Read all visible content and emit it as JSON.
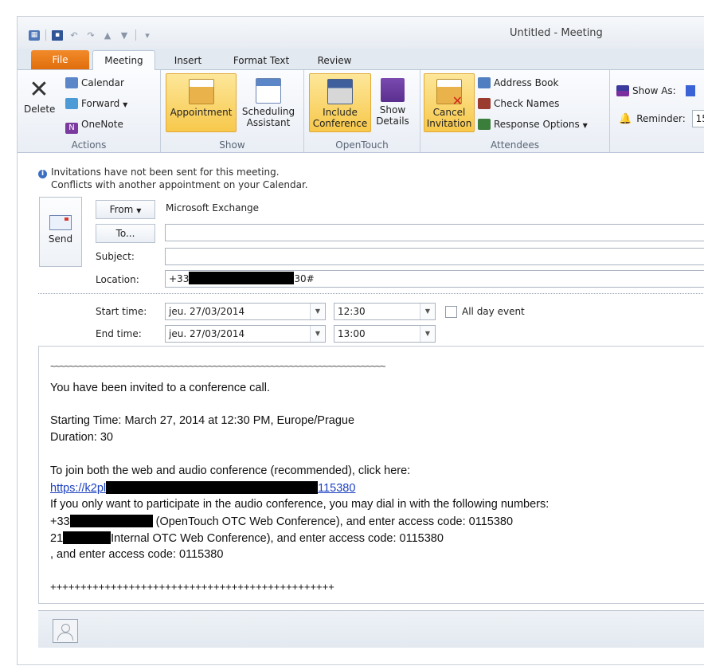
{
  "window": {
    "title": "Untitled - Meeting"
  },
  "tabs": [
    "File",
    "Meeting",
    "Insert",
    "Format Text",
    "Review"
  ],
  "ribbon": {
    "actions": {
      "label": "Actions",
      "delete": "Delete",
      "calendar": "Calendar",
      "forward": "Forward",
      "onenote": "OneNote"
    },
    "show": {
      "label": "Show",
      "appointment": "Appointment",
      "scheduling1": "Scheduling",
      "scheduling2": "Assistant"
    },
    "opentouch": {
      "label": "OpenTouch",
      "include1": "Include",
      "include2": "Conference",
      "show1": "Show",
      "show2": "Details"
    },
    "attendees": {
      "label": "Attendees",
      "cancel1": "Cancel",
      "cancel2": "Invitation",
      "address_book": "Address Book",
      "check_names": "Check Names",
      "response_options": "Response Options"
    },
    "options": {
      "show_as": "Show As:",
      "reminder": "Reminder:",
      "reminder_value": "15"
    }
  },
  "info": {
    "line1": "Invitations have not been sent for this meeting.",
    "line2": "Conflicts with another appointment on your Calendar."
  },
  "form": {
    "send": "Send",
    "from_btn": "From",
    "from_value": "Microsoft Exchange",
    "to_btn": "To...",
    "subject_label": "Subject:",
    "location_label": "Location:",
    "location_prefix": "+33",
    "location_suffix": "30#",
    "start_label": "Start time:",
    "end_label": "End time:",
    "start_date": "jeu. 27/03/2014",
    "start_time": "12:30",
    "end_date": "jeu. 27/03/2014",
    "end_time": "13:00",
    "all_day": "All day event"
  },
  "body": {
    "tilde_line": "~~~~~~~~~~~~~~~~~~~~~~~~~~~~~~~~~~~~~~~~~~~~~~~~~~~~~~~~~~~~~~~~~~~~~~",
    "invited": "You have been invited to a conference call.",
    "starting": "Starting Time: March 27, 2014 at 12:30 PM, Europe/Prague",
    "duration": "Duration: 30",
    "join": "To join both the web and audio conference (recommended), click here:",
    "link_prefix": "https://k2pl",
    "link_suffix": "115380",
    "audio_only": "If you only want to participate in the audio conference, you may dial in with the following numbers:",
    "dial1_prefix": "+33",
    "dial1_rest": " (OpenTouch OTC Web Conference), and enter access code: 0115380",
    "dial2_prefix": "21",
    "dial2_rest": "Internal OTC Web Conference), and enter access code: 0115380",
    "dial3": ", and enter access code: 0115380",
    "plus_line": "+++++++++++++++++++++++++++++++++++++++++++++++"
  }
}
